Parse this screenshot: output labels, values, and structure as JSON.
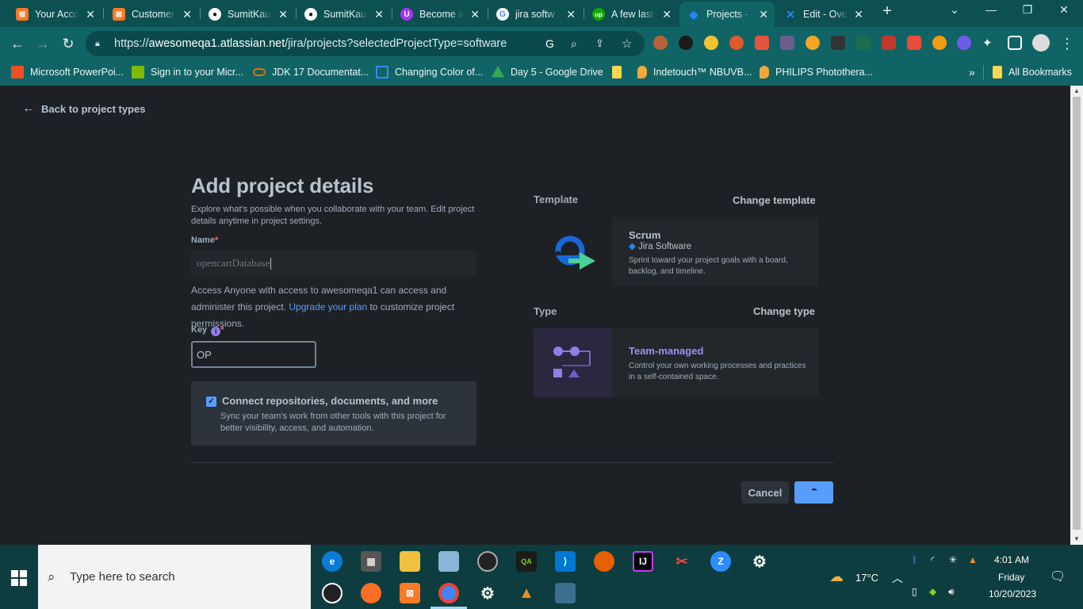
{
  "browser": {
    "tabs": [
      {
        "title": "Your Acco",
        "icon": "xampp-icon",
        "color": "#fb7a24"
      },
      {
        "title": "Customer",
        "icon": "xampp-icon",
        "color": "#fb7a24"
      },
      {
        "title": "SumitKau",
        "icon": "github-icon",
        "color": "#0c5052"
      },
      {
        "title": "SumitKau",
        "icon": "github-icon",
        "color": "#0c5052"
      },
      {
        "title": "Become a",
        "icon": "udemy-icon",
        "color": "#a435f0"
      },
      {
        "title": "jira softw",
        "icon": "google-icon",
        "color": "#ffffff"
      },
      {
        "title": "A few last",
        "icon": "upwork-icon",
        "color": "#14a800"
      },
      {
        "title": "Projects -",
        "icon": "jira-icon",
        "color": "#2684ff"
      },
      {
        "title": "Edit - Ove",
        "icon": "confluence-icon",
        "color": "#2684ff"
      }
    ],
    "new_tab": "+",
    "url_host": "awesomeqa1.atlassian.net",
    "url_prefix": "https://",
    "url_path": "/jira/projects?selectedProjectType=software",
    "bookmarks": [
      {
        "label": "Microsoft PowerPoi...",
        "color": "#f25022"
      },
      {
        "label": "Sign in to your Micr...",
        "color": "#7fba00"
      },
      {
        "label": "JDK 17 Documentat...",
        "color": "#e76f00"
      },
      {
        "label": "Changing Color of...",
        "color": "#4285f4"
      },
      {
        "label": "Day 5 - Google Drive",
        "color": "#34a853"
      },
      {
        "label": "",
        "color": "#ffd64f"
      },
      {
        "label": "Indetouch™ NBUVB...",
        "color": "#f2a93b"
      },
      {
        "label": "PHILIPS Photothera...",
        "color": "#f2a93b"
      }
    ],
    "more": "»",
    "all_bookmarks": "All Bookmarks"
  },
  "page": {
    "back_label": "Back to project types",
    "title": "Add project details",
    "description": "Explore what's possible when you collaborate with your team. Edit project details anytime in project settings.",
    "name_label": "Name",
    "name_value": "opencartDatabase",
    "access_prefix": "Access Anyone with access to awesomeqa1 can access and administer this project.",
    "access_link": "Upgrade your plan",
    "access_suffix": "to customize project permissions.",
    "key_label": "Key",
    "key_value": "OP",
    "required_mark": "*",
    "connect_title": "Connect repositories, documents, and more",
    "connect_desc": "Sync your team's work from other tools with this project for better visibility, access, and automation.",
    "template_heading": "Template",
    "change_template": "Change template",
    "template_name": "Scrum",
    "template_product": "Jira Software",
    "template_desc": "Sprint toward your project goals with a board, backlog, and timeline.",
    "type_heading": "Type",
    "change_type": "Change type",
    "type_name": "Team-managed",
    "type_desc": "Control your own working processes and practices in a self-contained space.",
    "cancel": "Cancel"
  },
  "taskbar": {
    "search_placeholder": "Type here to search",
    "weather": "17°C",
    "time": "4:01 AM",
    "day": "Friday",
    "date": "10/20/2023"
  },
  "colors": {
    "accent": "#579dff",
    "chrome_bg": "#116466",
    "page_bg": "#1d2125",
    "type_name": "#9f8fef"
  }
}
